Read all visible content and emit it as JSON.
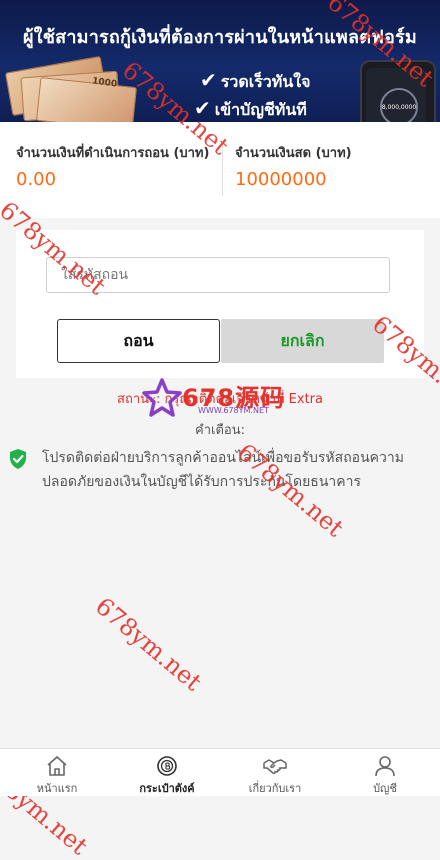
{
  "banner": {
    "title": "ผู้ใช้สามารถกู้เงินที่ต้องการผ่านในหน้าแพลตฟอร์ม",
    "points": [
      "รวดเร็วทันใจ",
      "เข้าบัญชีทันที"
    ],
    "bill_label": "1000",
    "phone_amount": "8,000,0000"
  },
  "balances": {
    "withdrawing": {
      "label": "จำนวนเงินที่ดำเนินการถอน (บาท)",
      "value": "0.00"
    },
    "cash": {
      "label": "จำนวนเงินสด (บาท)",
      "value": "10000000"
    }
  },
  "withdraw_form": {
    "code_placeholder": "ใส่รหัสถอน",
    "withdraw_label": "ถอน",
    "cancel_label": "ยกเลิก"
  },
  "status_text": "สถานะ: กรุณาติดต่อเจ้าหน้าที่ Extra",
  "warning": {
    "label": "คำเตือน:",
    "text": "โปรดติดต่อฝ่ายบริการลูกค้าออนไลน์เพื่อขอรับรหัสถอนความปลอดภัยของเงินในบัญชีได้รับการประกันโดยธนาคาร"
  },
  "watermark": {
    "text": "678ym.net",
    "logo": "678源码",
    "logo_url": "WWW.678YM.NET"
  },
  "tabbar": [
    {
      "label": "หน้าแรก",
      "icon": "home-icon",
      "active": false
    },
    {
      "label": "กระเป๋าตังค์",
      "icon": "wallet-icon",
      "active": true
    },
    {
      "label": "เกี่ยวกับเรา",
      "icon": "handshake-icon",
      "active": false
    },
    {
      "label": "บัญชี",
      "icon": "user-icon",
      "active": false
    }
  ],
  "colors": {
    "banner": "#142a6b",
    "amount": "#ff6a13",
    "status": "#e03030",
    "cancel_text": "#1a9a2a",
    "shield": "#22b04a",
    "watermark": "#e4322b"
  }
}
